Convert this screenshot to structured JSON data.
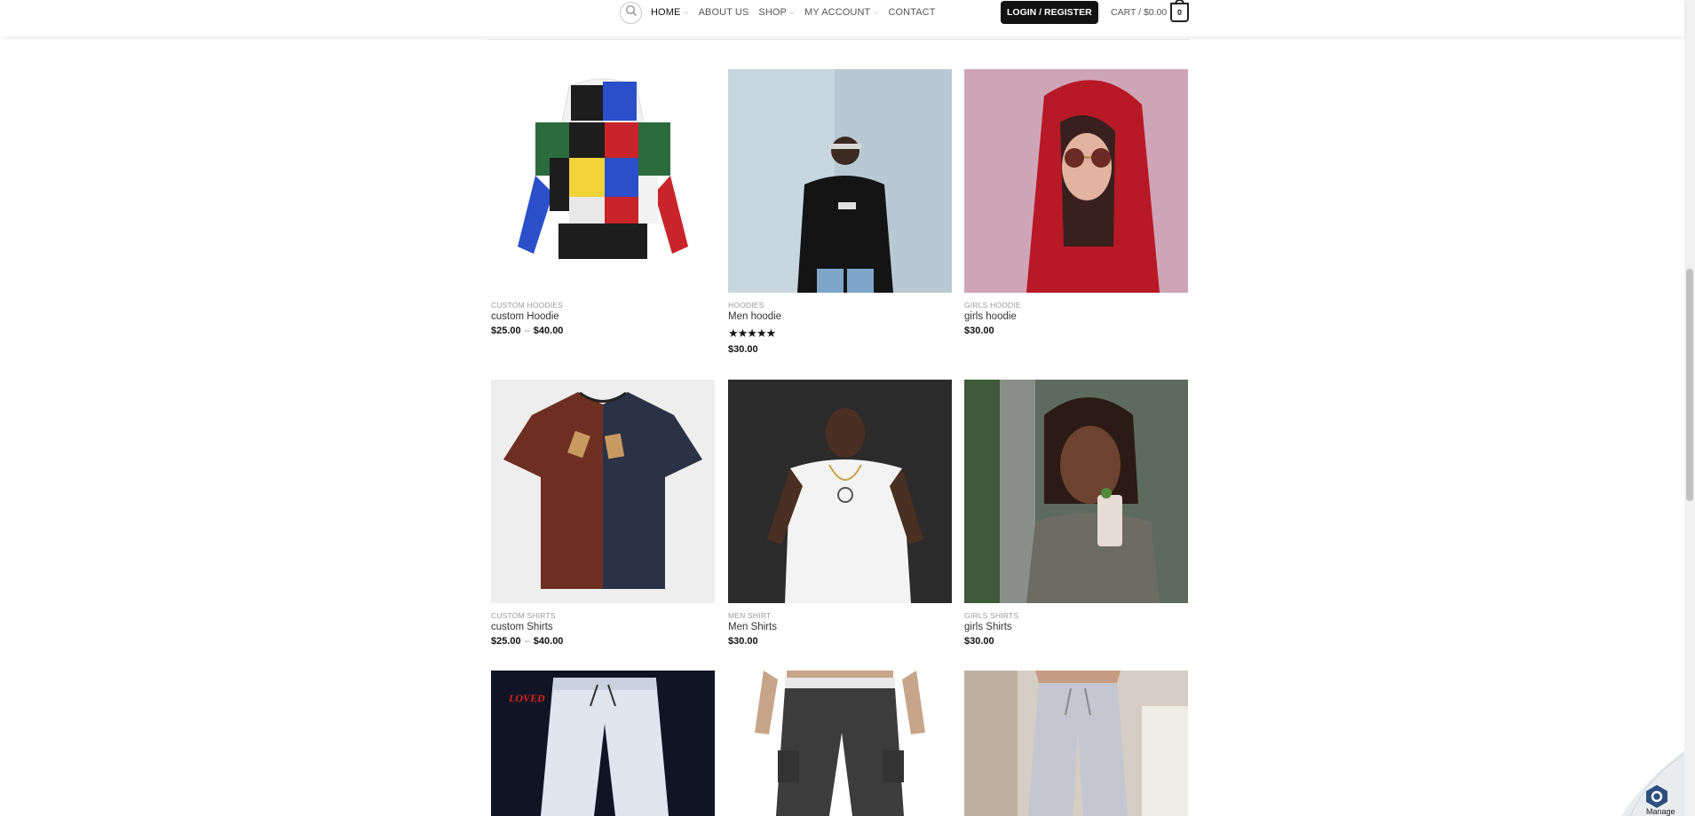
{
  "header": {
    "nav": [
      {
        "label": "HOME",
        "dropdown": true,
        "active": true
      },
      {
        "label": "ABOUT US",
        "dropdown": false,
        "active": false
      },
      {
        "label": "SHOP",
        "dropdown": true,
        "active": false
      },
      {
        "label": "MY ACCOUNT",
        "dropdown": true,
        "active": false
      },
      {
        "label": "CONTACT",
        "dropdown": false,
        "active": false
      }
    ],
    "login_label": "LOGIN / REGISTER",
    "cart_label": "CART / $0.00",
    "cart_count": "0"
  },
  "products": [
    {
      "category": "CUSTOM HOODIES",
      "name": "custom Hoodie",
      "price_min": "$25.00",
      "price_max": "$40.00",
      "icon": "patchwork-hoodie-image"
    },
    {
      "category": "HOODIES",
      "name": "Men hoodie",
      "price": "$30.00",
      "rating": 5,
      "icon": "man-in-black-hoodie-image"
    },
    {
      "category": "GIRLS HOODIE",
      "name": "girls hoodie",
      "price": "$30.00",
      "icon": "woman-in-red-hoodie-image"
    },
    {
      "category": "CUSTOM SHIRTS",
      "name": "custom Shirts",
      "price_min": "$25.00",
      "price_max": "$40.00",
      "icon": "two-tone-tshirt-image"
    },
    {
      "category": "MEN SHIRT",
      "name": "Men Shirts",
      "price": "$30.00",
      "icon": "man-in-white-tshirt-image"
    },
    {
      "category": "GIRLS SHIRTS",
      "name": "girls Shirts",
      "price": "$30.00",
      "icon": "woman-with-drink-image"
    },
    {
      "category": "",
      "name": "",
      "price": "",
      "icon": "reflective-joggers-image",
      "overlay_text": "LOVED"
    },
    {
      "category": "",
      "name": "",
      "price": "",
      "icon": "grey-cargo-joggers-image"
    },
    {
      "category": "",
      "name": "",
      "price": "",
      "icon": "grey-sweatpants-image"
    }
  ],
  "stars_text": "★★★★★",
  "price_dash": "–",
  "manage_label": "Manage",
  "colors": {
    "accent": "#111111",
    "link": "#333333",
    "muted": "#9a9a9a"
  }
}
